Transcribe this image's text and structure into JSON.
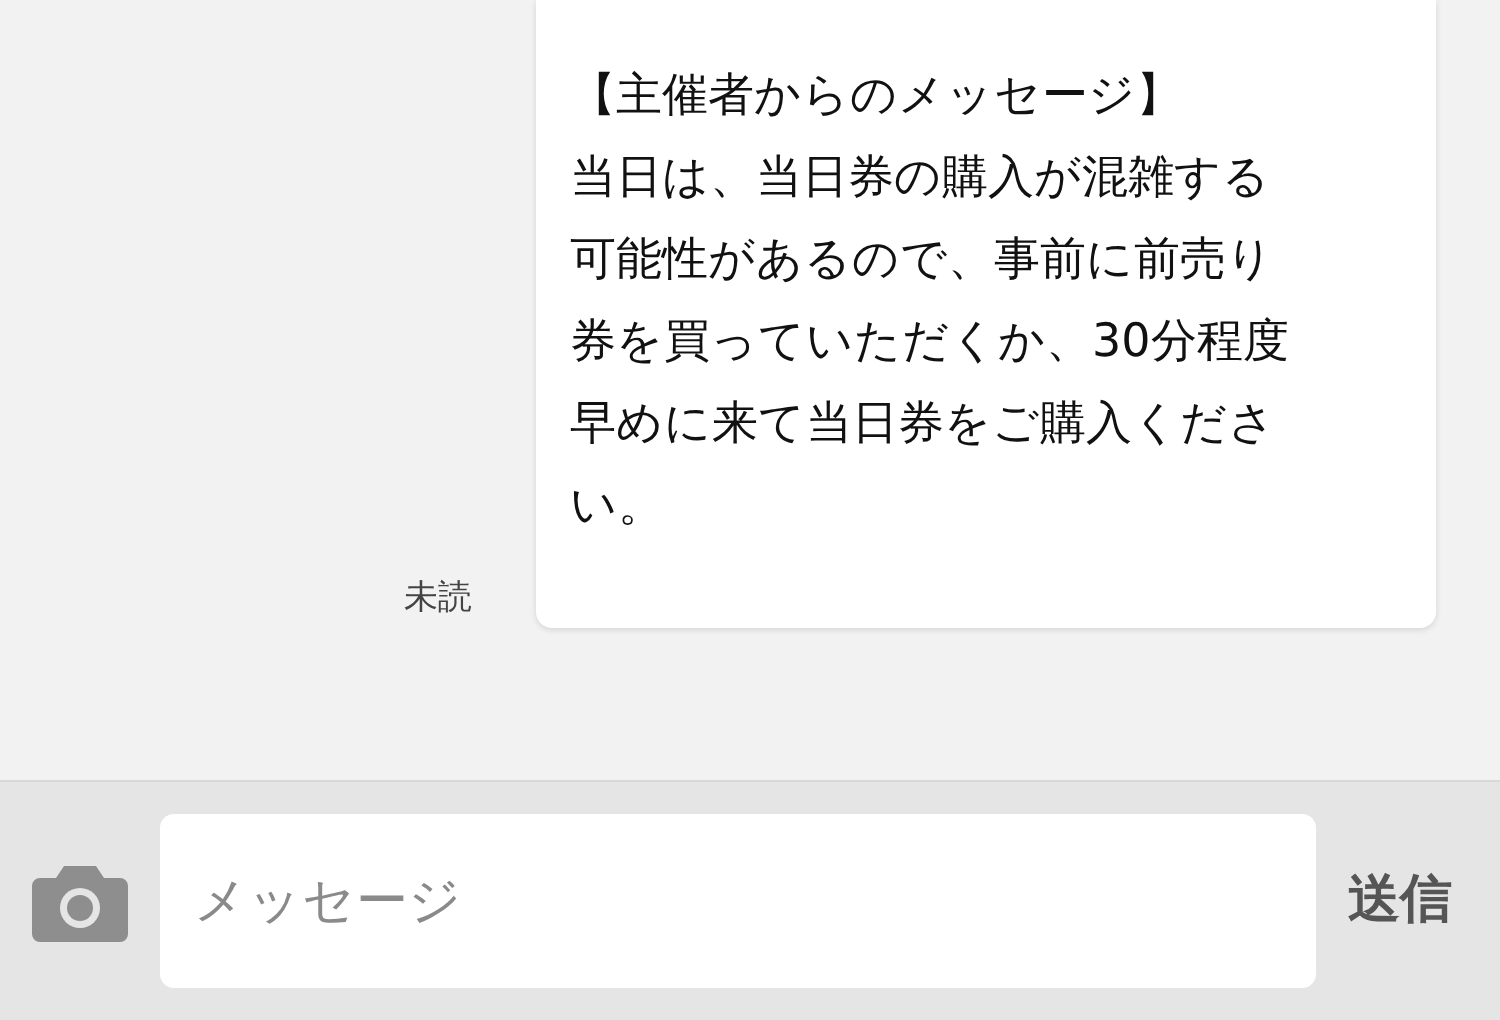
{
  "message": {
    "lines": [
      "【主催者からのメッセージ】",
      "当日は、当日券の購入が混雑する",
      "可能性があるので、事前に前売り",
      "券を買っていただくか、30分程度",
      "早めに来て当日券をご購入くださ",
      "い。"
    ],
    "status": "未読"
  },
  "composer": {
    "placeholder": "メッセージ",
    "send": "送信"
  }
}
